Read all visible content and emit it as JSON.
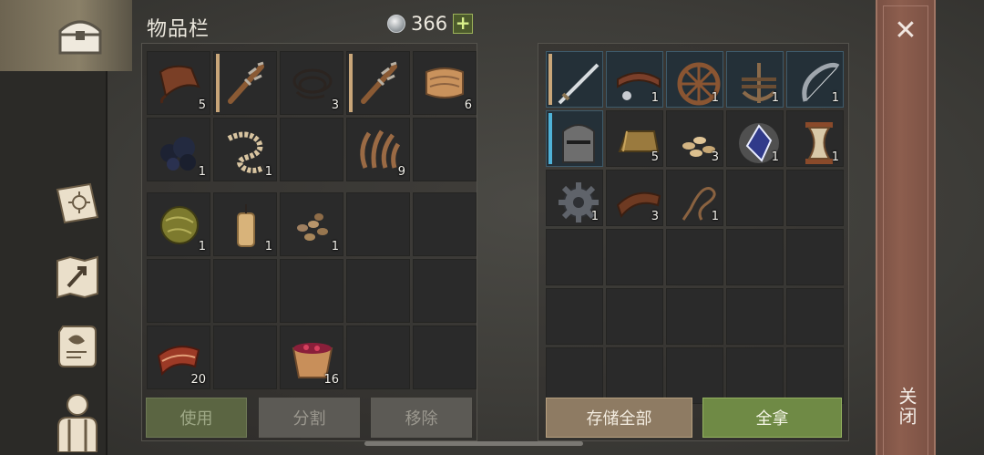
{
  "header": {
    "title": "物品栏",
    "currency_value": "366",
    "add_symbol": "+"
  },
  "inventory": {
    "upper": [
      {
        "icon": "leather-icon",
        "count": "5"
      },
      {
        "icon": "spiked-club-icon",
        "count": "",
        "bar": "tan"
      },
      {
        "icon": "rope-coil-icon",
        "count": "3"
      },
      {
        "icon": "spiked-club-icon",
        "count": "",
        "bar": "tan"
      },
      {
        "icon": "cloth-icon",
        "count": "6"
      },
      {
        "icon": "coal-icon",
        "count": "1"
      },
      {
        "icon": "rope-icon",
        "count": "1"
      },
      {
        "icon": "empty",
        "count": ""
      },
      {
        "icon": "grass-fiber-icon",
        "count": "9"
      },
      {
        "icon": "empty",
        "count": ""
      }
    ],
    "lower": [
      {
        "icon": "herb-ball-icon",
        "count": "1"
      },
      {
        "icon": "candle-icon",
        "count": "1"
      },
      {
        "icon": "seeds-icon",
        "count": "1"
      },
      {
        "icon": "empty",
        "count": ""
      },
      {
        "icon": "empty",
        "count": ""
      },
      {
        "icon": "empty",
        "count": ""
      },
      {
        "icon": "empty",
        "count": ""
      },
      {
        "icon": "empty",
        "count": ""
      },
      {
        "icon": "empty",
        "count": ""
      },
      {
        "icon": "empty",
        "count": ""
      },
      {
        "icon": "meat-icon",
        "count": "20"
      },
      {
        "icon": "empty",
        "count": ""
      },
      {
        "icon": "berry-bowl-icon",
        "count": "16"
      },
      {
        "icon": "empty",
        "count": ""
      },
      {
        "icon": "empty",
        "count": ""
      }
    ]
  },
  "storage": {
    "cells": [
      {
        "icon": "sword-icon",
        "count": "",
        "bar": "tan",
        "hl": true
      },
      {
        "icon": "collar-icon",
        "count": "1",
        "hl": true
      },
      {
        "icon": "wheel-icon",
        "count": "1",
        "hl": true
      },
      {
        "icon": "anchor-rack-icon",
        "count": "1",
        "hl": true
      },
      {
        "icon": "bow-icon",
        "count": "1",
        "hl": true
      },
      {
        "icon": "helmet-icon",
        "count": "",
        "bar": "blue",
        "hl": true
      },
      {
        "icon": "ingot-icon",
        "count": "5"
      },
      {
        "icon": "grain-icon",
        "count": "3"
      },
      {
        "icon": "crystal-icon",
        "count": "1"
      },
      {
        "icon": "hourglass-icon",
        "count": "1"
      },
      {
        "icon": "gear-icon",
        "count": "1"
      },
      {
        "icon": "leather-strip-icon",
        "count": "3"
      },
      {
        "icon": "whip-icon",
        "count": "1"
      },
      {
        "icon": "empty",
        "count": ""
      },
      {
        "icon": "empty",
        "count": ""
      },
      {
        "icon": "empty",
        "count": ""
      },
      {
        "icon": "empty",
        "count": ""
      },
      {
        "icon": "empty",
        "count": ""
      },
      {
        "icon": "empty",
        "count": ""
      },
      {
        "icon": "empty",
        "count": ""
      },
      {
        "icon": "empty",
        "count": ""
      },
      {
        "icon": "empty",
        "count": ""
      },
      {
        "icon": "empty",
        "count": ""
      },
      {
        "icon": "empty",
        "count": ""
      },
      {
        "icon": "empty",
        "count": ""
      },
      {
        "icon": "empty",
        "count": ""
      },
      {
        "icon": "empty",
        "count": ""
      },
      {
        "icon": "empty",
        "count": ""
      },
      {
        "icon": "empty",
        "count": ""
      },
      {
        "icon": "empty",
        "count": ""
      }
    ]
  },
  "buttons": {
    "use": "使用",
    "split": "分割",
    "remove": "移除",
    "store_all": "存储全部",
    "take_all": "全拿"
  },
  "close": {
    "symbol": "✕",
    "label": "关闭"
  },
  "sidebar": {
    "items": [
      "inventory-chest-icon",
      "crafting-book-icon",
      "map-icon",
      "quest-scroll-icon",
      "character-icon"
    ]
  }
}
